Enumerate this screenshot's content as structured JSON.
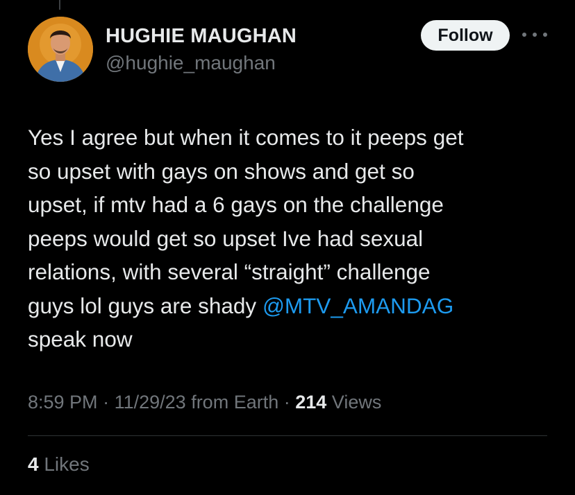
{
  "author": {
    "name": "HUGHIE MAUGHAN",
    "handle": "@hughie_maughan"
  },
  "follow_button": {
    "label": "Follow"
  },
  "more_menu": {
    "icon": "more-horizontal-icon"
  },
  "tweet": {
    "lines": [
      "Yes I agree but when it comes to it peeps get",
      "so upset with gays on shows and get so",
      "upset, if mtv had a 6 gays on the challenge",
      "peeps would get so upset Ive  had sexual",
      "relations, with several “straight” challenge",
      "guys lol guys are shady "
    ],
    "mention": "@MTV_AMANDAG",
    "last_line": "speak now"
  },
  "meta": {
    "time": "8:59 PM",
    "date": "11/29/23",
    "location": "from Earth",
    "separator": " · ",
    "views_count": "214",
    "views_label": " Views"
  },
  "engagement": {
    "likes_count": "4",
    "likes_label": " Likes"
  },
  "colors": {
    "background": "#000000",
    "text": "#e7e9ea",
    "secondary": "#71767b",
    "link": "#1d9bf0",
    "button_bg": "#eff3f4"
  }
}
